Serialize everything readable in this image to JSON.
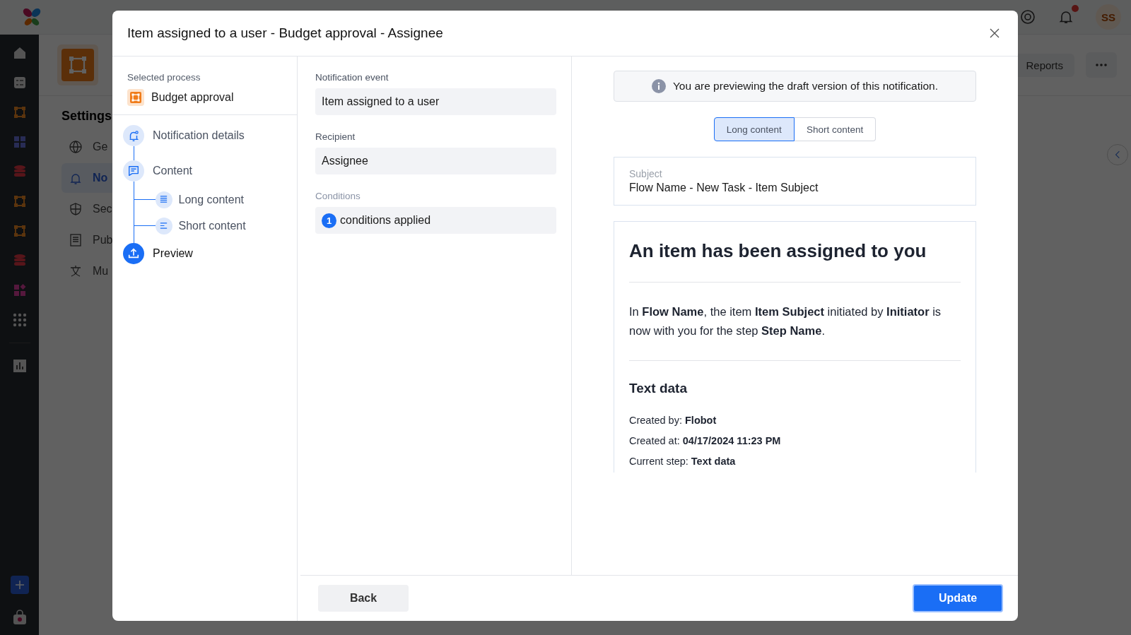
{
  "background": {
    "page_title": "Settings",
    "menu": [
      {
        "label": "Ge",
        "kind": "globe",
        "selected": false
      },
      {
        "label": "No",
        "kind": "bell",
        "selected": true
      },
      {
        "label": "Sec",
        "kind": "shield",
        "selected": false
      },
      {
        "label": "Pub",
        "kind": "doc",
        "selected": false
      },
      {
        "label": "Mu",
        "kind": "lang",
        "selected": false
      }
    ],
    "reports_button": "Reports",
    "avatar": "SS",
    "notifications_unread": true
  },
  "modal": {
    "title": "Item assigned to a user - Budget approval - Assignee",
    "selected_process_label": "Selected process",
    "process": "Budget approval",
    "steps": [
      {
        "label": "Notification details",
        "kind": "bell",
        "selected": false
      },
      {
        "label": "Content",
        "kind": "content",
        "selected": false,
        "children": [
          {
            "label": "Long content",
            "kind": "long"
          },
          {
            "label": "Short content",
            "kind": "short"
          }
        ]
      },
      {
        "label": "Preview",
        "kind": "preview",
        "selected": true
      }
    ],
    "fields": [
      {
        "label": "Notification event",
        "value": "Item assigned to a user",
        "kind": "text",
        "disabled": false
      },
      {
        "label": "Recipient",
        "value": "Assignee",
        "kind": "text",
        "disabled": false
      },
      {
        "label": "Conditions",
        "count": "1",
        "value": "conditions applied",
        "kind": "conditions",
        "disabled": true
      }
    ],
    "preview": {
      "notice": "You are previewing the draft version of this notification.",
      "tabs": [
        {
          "label": "Long content",
          "selected": true
        },
        {
          "label": "Short content",
          "selected": false
        }
      ],
      "subject_label": "Subject",
      "subject": "Flow Name - New Task - Item Subject",
      "heading": "An item has been assigned to you",
      "paragraph": "In **Flow Name**, the item **Item Subject** initiated by **Initiator** is now with you for the step **Step Name**.",
      "section_title": "Text data",
      "details": [
        "Created by: **Flobot**",
        "Created at: **04/17/2024 11:23 PM**",
        "Current step: **Text data**"
      ]
    },
    "footer": {
      "back": "Back",
      "update": "Update"
    }
  }
}
